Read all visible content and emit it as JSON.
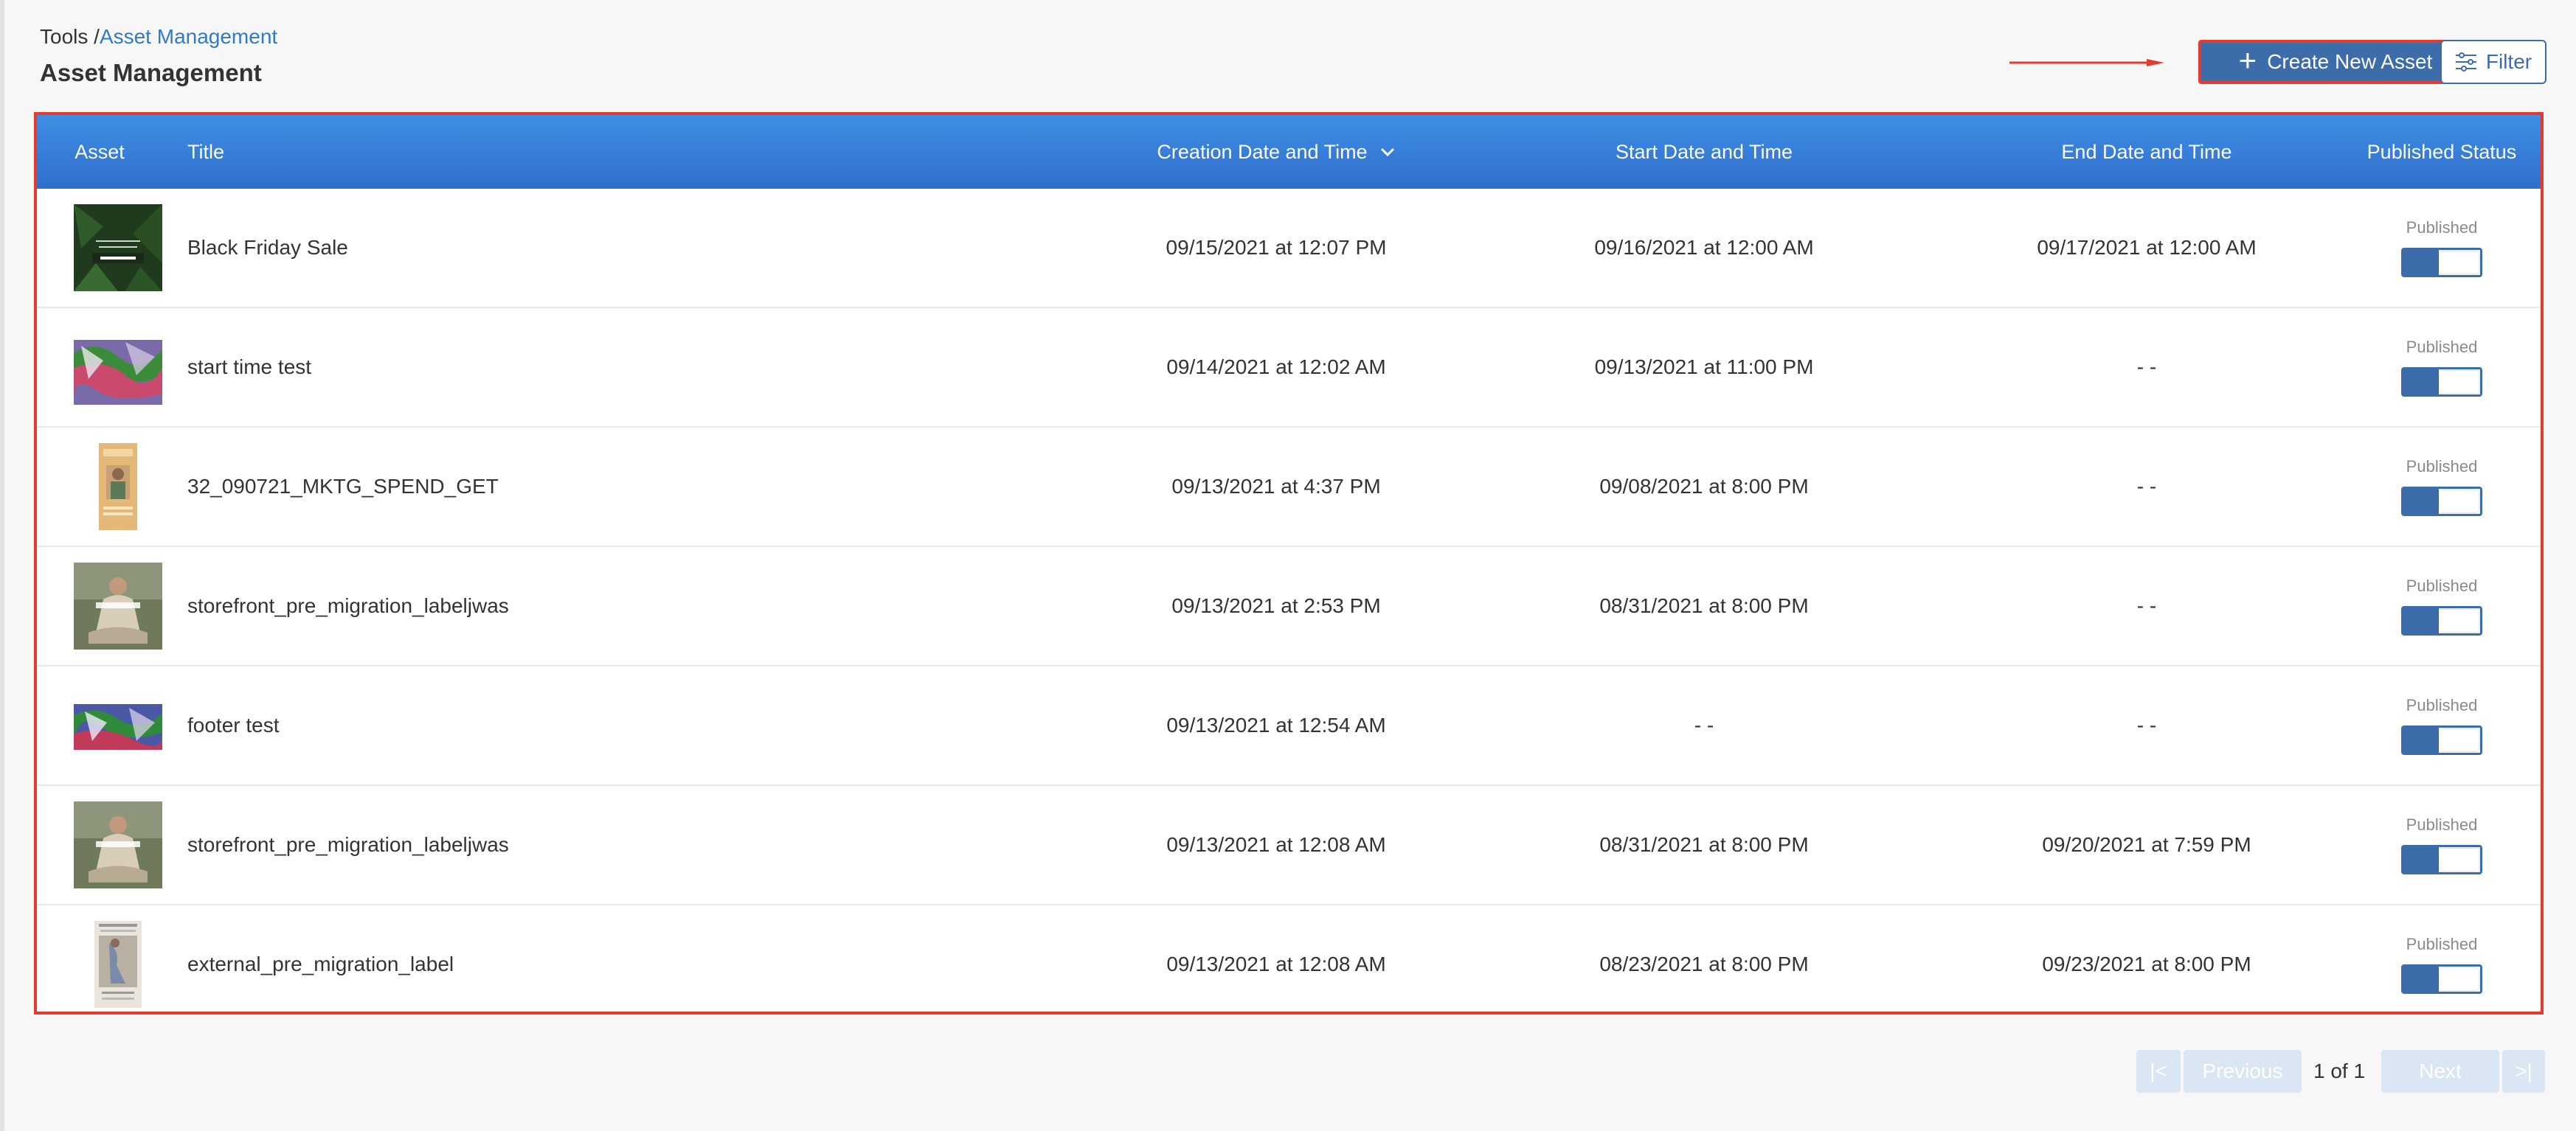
{
  "breadcrumb": {
    "root": "Tools /",
    "current": "Asset Management"
  },
  "page_title": "Asset Management",
  "toolbar": {
    "create_label": "Create New Asset",
    "filter_label": "Filter"
  },
  "accent_color": "#3d6cab",
  "highlight_color": "#e33b2e",
  "table": {
    "headers": {
      "asset": "Asset",
      "title": "Title",
      "creation": "Creation Date and Time",
      "start": "Start Date and Time",
      "end": "End Date and Time",
      "status": "Published Status"
    },
    "sort_icon": "chevron-down-icon",
    "rows": [
      {
        "title": "Black Friday Sale",
        "created": "09/15/2021 at 12:07 PM",
        "start": "09/16/2021 at 12:00 AM",
        "end": "09/17/2021 at 12:00 AM",
        "status": "Published",
        "published": true
      },
      {
        "title": "start time test",
        "created": "09/14/2021 at 12:02 AM",
        "start": "09/13/2021 at 11:00 PM",
        "end": "- -",
        "status": "Published",
        "published": true
      },
      {
        "title": "32_090721_MKTG_SPEND_GET",
        "created": "09/13/2021 at 4:37 PM",
        "start": "09/08/2021 at 8:00 PM",
        "end": "- -",
        "status": "Published",
        "published": true
      },
      {
        "title": "storefront_pre_migration_labeljwas",
        "created": "09/13/2021 at 2:53 PM",
        "start": "08/31/2021 at 8:00 PM",
        "end": "- -",
        "status": "Published",
        "published": true
      },
      {
        "title": "footer test",
        "created": "09/13/2021 at 12:54 AM",
        "start": "- -",
        "end": "- -",
        "status": "Published",
        "published": true
      },
      {
        "title": "storefront_pre_migration_labeljwas",
        "created": "09/13/2021 at 12:08 AM",
        "start": "08/31/2021 at 8:00 PM",
        "end": "09/20/2021 at 7:59 PM",
        "status": "Published",
        "published": true
      },
      {
        "title": "external_pre_migration_label",
        "created": "09/13/2021 at 12:08 AM",
        "start": "08/23/2021 at 8:00 PM",
        "end": "09/23/2021 at 8:00 PM",
        "status": "Published",
        "published": true
      }
    ]
  },
  "pagination": {
    "first": "|<",
    "previous": "Previous",
    "info": "1 of 1",
    "next": "Next",
    "last": ">|"
  }
}
